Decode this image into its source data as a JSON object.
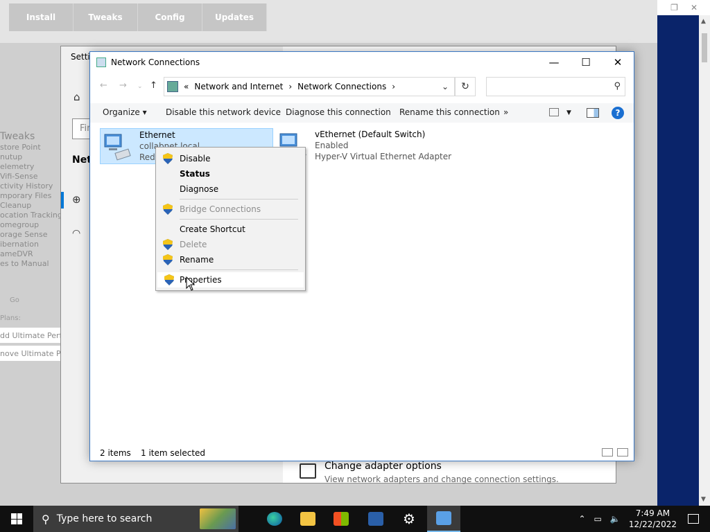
{
  "bg_app": {
    "tabs": [
      "Install",
      "Tweaks",
      "Config",
      "Updates"
    ],
    "left_header": "Tweaks",
    "left_items": [
      "store Point",
      "nutup",
      "elemetry",
      "Vifi-Sense",
      "ctivity History",
      "mporary Files",
      "Cleanup",
      "ocation Tracking",
      "omegroup",
      "orage Sense",
      "ibernation",
      "ameDVR",
      "es to Manual"
    ],
    "go_label": "Go",
    "plans_label": "Plans:",
    "add_ultimate": "dd Ultimate Perfo",
    "remove_ultimate": "nove Ultimate Perfo"
  },
  "settings": {
    "title": "Setti",
    "find_placeholder": "Fir",
    "section_title": "Netw",
    "change_adapter_title": "Change adapter options",
    "change_adapter_desc": "View network adapters and change connection settings."
  },
  "window": {
    "title": "Network Connections",
    "breadcrumb": [
      "«",
      "Network and Internet",
      "›",
      "Network Connections",
      "›"
    ],
    "search_placeholder": ""
  },
  "toolbar": {
    "organize": "Organize ▾",
    "disable": "Disable this network device",
    "diagnose": "Diagnose this connection",
    "rename": "Rename this connection",
    "more": "»"
  },
  "items": [
    {
      "name": "Ethernet",
      "line2": "collabnet.local",
      "line3": "Red",
      "selected": true
    },
    {
      "name": "vEthernet (Default Switch)",
      "line2": "Enabled",
      "line3": "Hyper-V Virtual Ethernet Adapter",
      "selected": false
    }
  ],
  "status": {
    "count": "2 items",
    "selected": "1 item selected"
  },
  "context_menu": {
    "disable": "Disable",
    "status": "Status",
    "diagnose": "Diagnose",
    "bridge": "Bridge Connections",
    "shortcut": "Create Shortcut",
    "delete": "Delete",
    "rename": "Rename",
    "properties": "Properties"
  },
  "taskbar": {
    "search_placeholder": "Type here to search",
    "time": "7:49 AM",
    "date": "12/22/2022"
  },
  "colors": {
    "accent": "#0078d7",
    "selection": "#cce8ff",
    "taskbar": "#101010"
  }
}
